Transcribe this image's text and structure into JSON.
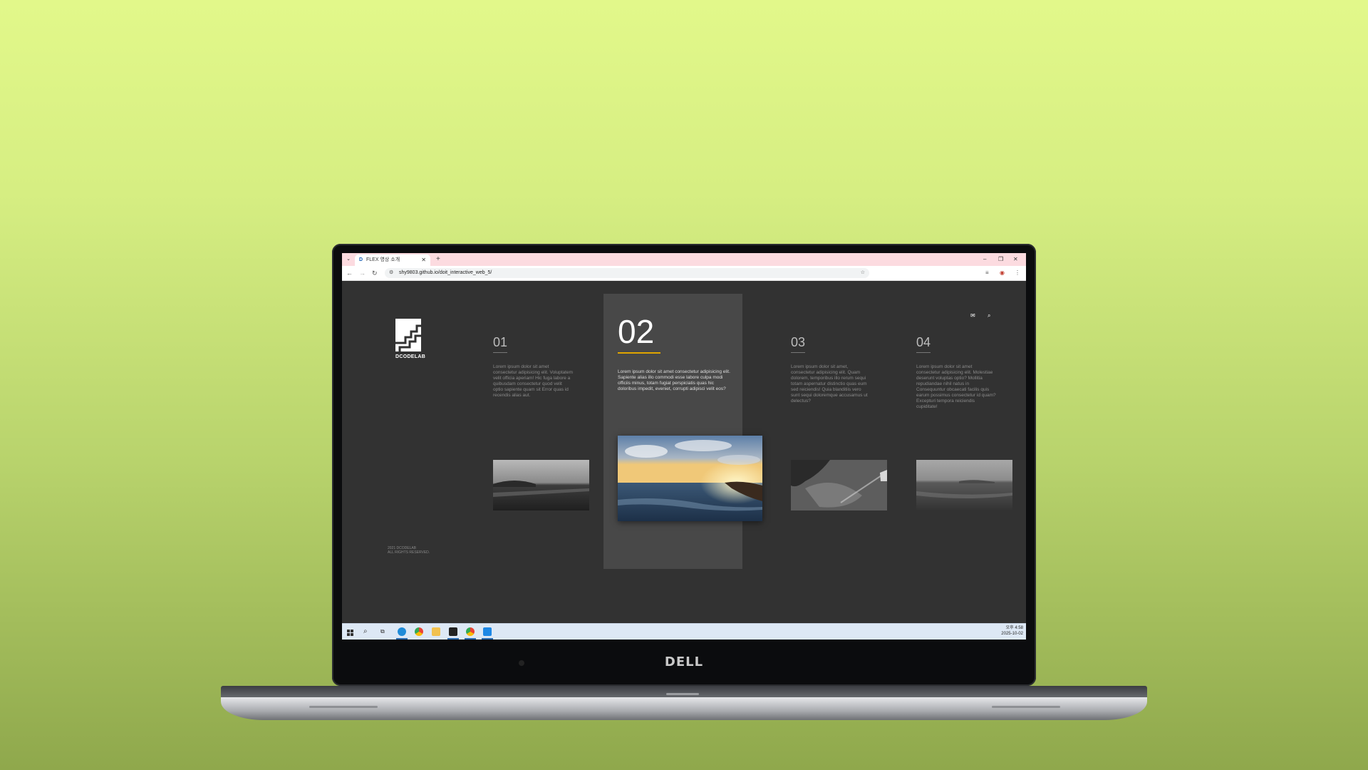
{
  "device": {
    "brand": "DELL"
  },
  "browser": {
    "tab_title": "FLEX 영상 소개",
    "tab_favicon": "D",
    "new_tab": "+",
    "address": "shy9803.github.io/doit_interactive_web_5/"
  },
  "site": {
    "brand": "DCODELAB",
    "copyright_line1": "2021 DCODELAB",
    "copyright_line2": "ALL RIGHTS RESERVED.",
    "accent_color": "#e0a500",
    "columns": [
      {
        "num": "01",
        "desc": "Lorem ipsum dolor sit amet consectetur adipisicing elit. Voluptatem velit officia aperiam! Hic fuga labore a quibusdam consectetur quod velit optio sapiente quam sit Error quas id recendis alias aut."
      },
      {
        "num": "02",
        "desc": "Lorem ipsum dolor sit amet consectetur adipisicing elit. Sapiente alias illo commodi esse labore culpa modi officiis minus, totam fugiat perspiciatis quas hic doloribus impedit, eveniet, corrupti adipisci velit eos?"
      },
      {
        "num": "03",
        "desc": "Lorem ipsum dolor sit amet, consectetur adipisicing elit. Quam dolorem, temporibus illo rerum sequi totam aspernatur distinctio quas eum sed reiciendis! Quia blanditiis vero sunt sequi doloremque accusamus ut delectus?"
      },
      {
        "num": "04",
        "desc": "Lorem ipsum dolor sit amet consectetur adipisicing elit. Molestiae deserunt voluptas optio? Mollitia repudiandae nihil natus in Consequuntur obcaecati facilis quis earum possimus consectetur id quam? Excepturi tempora reiciendis cupiditate!"
      }
    ]
  },
  "taskbar": {
    "time": "오후 4:58",
    "date": "2025-10-02"
  }
}
